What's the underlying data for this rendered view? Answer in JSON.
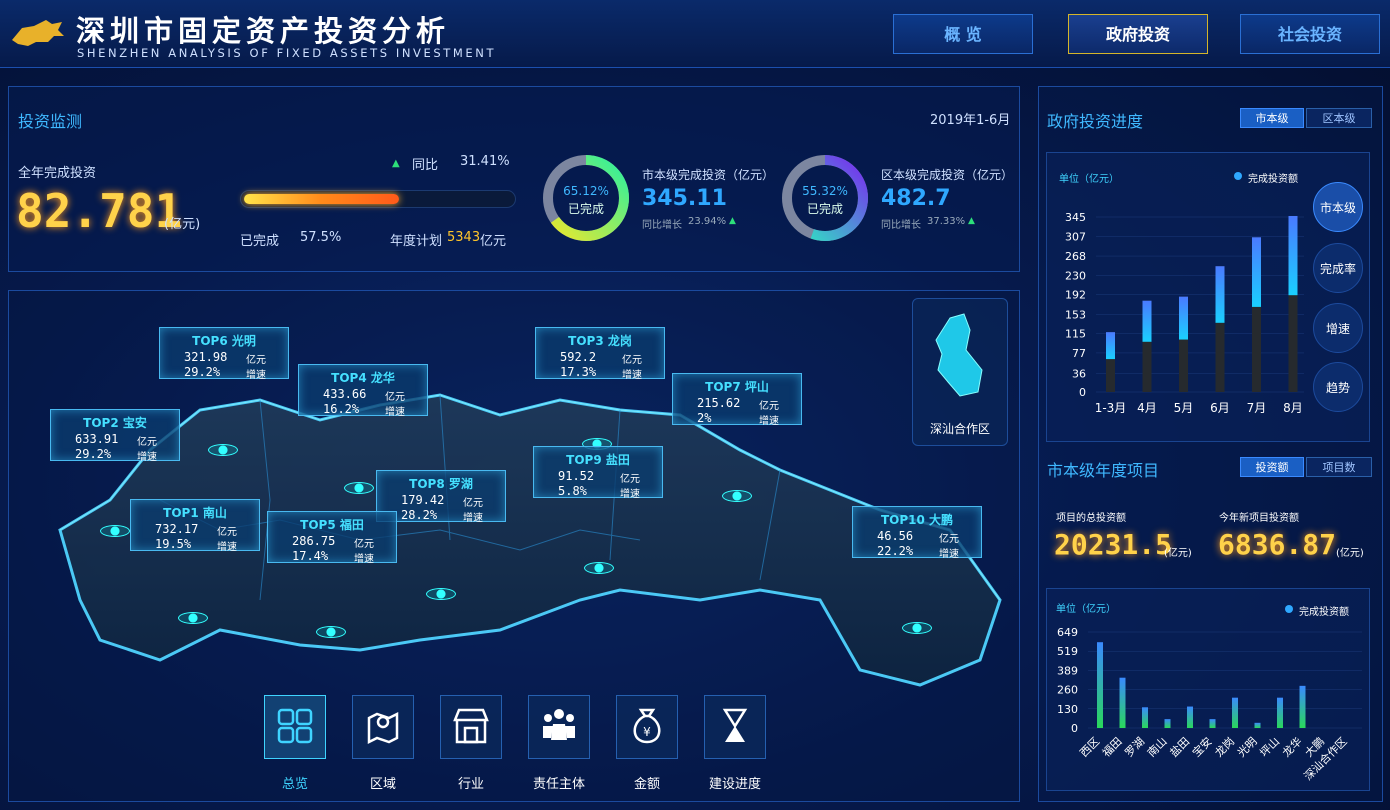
{
  "header": {
    "title": "深圳市固定资产投资分析",
    "subtitle": "SHENZHEN ANALYSIS OF FIXED ASSETS INVESTMENT",
    "nav": [
      {
        "label": "概 览"
      },
      {
        "label": "政府投资"
      },
      {
        "label": "社会投资"
      }
    ],
    "active_nav": 1
  },
  "monitor": {
    "title": "投资监测",
    "date": "2019年1-6月",
    "annual_label": "全年完成投资",
    "annual_value": "82.781",
    "annual_unit": "(亿元)",
    "yoy_label": "同比",
    "yoy_value": "31.41%",
    "progress_fraction": 0.575,
    "done_label": "已完成",
    "done_value": "57.5%",
    "plan_label": "年度计划",
    "plan_value": "5343",
    "plan_unit": "亿元",
    "city": {
      "pct": "65.12%",
      "pct_fraction": 0.6512,
      "ring_label": "已完成",
      "label": "市本级完成投资（亿元）",
      "value": "345.11",
      "growth_label": "同比增长",
      "growth": "23.94%"
    },
    "district": {
      "pct": "55.32%",
      "pct_fraction": 0.5532,
      "ring_label": "已完成",
      "label": "区本级完成投资（亿元）",
      "value": "482.7",
      "growth_label": "同比增长",
      "growth": "37.33%"
    }
  },
  "map": {
    "inset_label": "深汕合作区",
    "unit1": "亿元",
    "unit2": "增速",
    "tags": [
      {
        "title": "TOP6 光明",
        "value": "321.98",
        "rate": "29.2%"
      },
      {
        "title": "TOP4 龙华",
        "value": "433.66",
        "rate": "16.2%"
      },
      {
        "title": "TOP3 龙岗",
        "value": "592.2",
        "rate": "17.3%"
      },
      {
        "title": "TOP7 坪山",
        "value": "215.62",
        "rate": "2%"
      },
      {
        "title": "TOP2 宝安",
        "value": "633.91",
        "rate": "29.2%"
      },
      {
        "title": "TOP9 盐田",
        "value": "91.52",
        "rate": "5.8%"
      },
      {
        "title": "TOP8 罗湖",
        "value": "179.42",
        "rate": "28.2%"
      },
      {
        "title": "TOP1 南山",
        "value": "732.17",
        "rate": "19.5%"
      },
      {
        "title": "TOP5 福田",
        "value": "286.75",
        "rate": "17.4%"
      },
      {
        "title": "TOP10 大鹏",
        "value": "46.56",
        "rate": "22.2%"
      }
    ]
  },
  "toolbar": [
    {
      "label": "总览",
      "icon": "grid-icon"
    },
    {
      "label": "区域",
      "icon": "map-pin-icon"
    },
    {
      "label": "行业",
      "icon": "store-icon"
    },
    {
      "label": "责任主体",
      "icon": "people-icon"
    },
    {
      "label": "金额",
      "icon": "money-bag-icon"
    },
    {
      "label": "建设进度",
      "icon": "hourglass-icon"
    }
  ],
  "gov_progress": {
    "title": "政府投资进度",
    "seg": [
      "市本级",
      "区本级"
    ],
    "unit": "单位（亿元）",
    "legend": "完成投资额",
    "side": [
      "市本级",
      "完成率",
      "增速",
      "趋势"
    ]
  },
  "annual_projects": {
    "title": "市本级年度项目",
    "seg": [
      "投资额",
      "项目数"
    ],
    "total_label": "项目的总投资额",
    "total_value": "20231.5",
    "total_unit": "(亿元)",
    "new_label": "今年新项目投资额",
    "new_value": "6836.87",
    "new_unit": "(亿元)",
    "unit": "单位（亿元）",
    "legend": "完成投资额"
  },
  "chart_data": [
    {
      "type": "bar",
      "title": "",
      "ylabel": "单位（亿元）",
      "categories": [
        "1-3月",
        "4月",
        "5月",
        "6月",
        "7月",
        "8月"
      ],
      "yticks": [
        "0",
        "36",
        "77",
        "115",
        "153",
        "192",
        "230",
        "268",
        "307",
        "345"
      ],
      "ylim": [
        0,
        345
      ],
      "series": [
        {
          "name": "完成投资额",
          "values": [
            118,
            180,
            188,
            248,
            305,
            347
          ]
        }
      ]
    },
    {
      "type": "bar",
      "title": "",
      "ylabel": "单位（亿元）",
      "categories": [
        "西区",
        "福田",
        "罗湖",
        "南山",
        "盐田",
        "宝安",
        "龙岗",
        "光明",
        "坪山",
        "龙华",
        "大鹏",
        "深汕合作区"
      ],
      "yticks": [
        "0",
        "130",
        "260",
        "389",
        "519",
        "649"
      ],
      "ylim": [
        0,
        649
      ],
      "series": [
        {
          "name": "完成投资额",
          "values": [
            580,
            340,
            140,
            60,
            145,
            60,
            205,
            35,
            205,
            285,
            0,
            0
          ]
        }
      ]
    }
  ]
}
